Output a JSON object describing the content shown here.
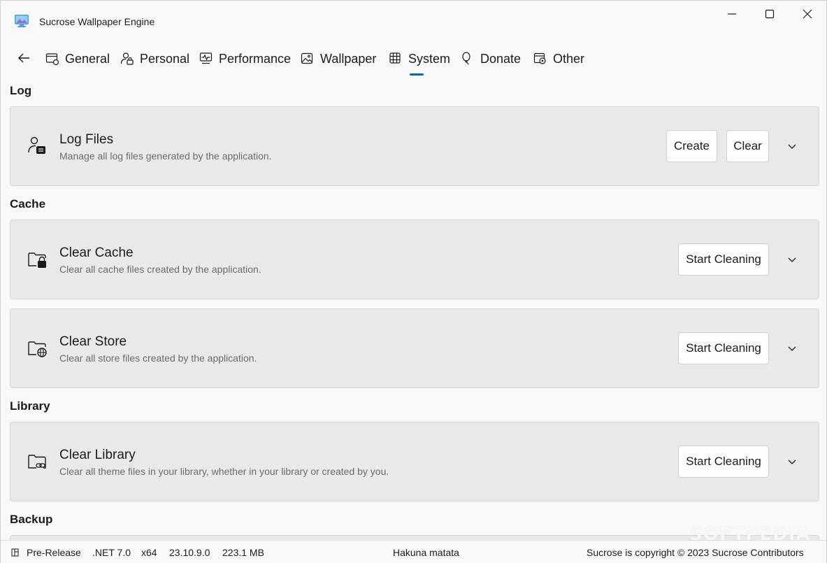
{
  "window": {
    "title": "Sucrose Wallpaper Engine"
  },
  "nav": {
    "tabs": [
      {
        "label": "General",
        "icon": "general-icon"
      },
      {
        "label": "Personal",
        "icon": "personal-lock-icon"
      },
      {
        "label": "Performance",
        "icon": "performance-icon"
      },
      {
        "label": "Wallpaper",
        "icon": "image-icon"
      },
      {
        "label": "System",
        "icon": "system-icon",
        "selected": true
      },
      {
        "label": "Donate",
        "icon": "balloon-icon"
      },
      {
        "label": "Other",
        "icon": "other-gear-icon"
      }
    ],
    "accent_color": "#0067c0"
  },
  "sections": {
    "log": {
      "title": "Log",
      "card": {
        "title": "Log Files",
        "description": "Manage all log files generated by the application.",
        "buttons": [
          "Create",
          "Clear"
        ]
      }
    },
    "cache": {
      "title": "Cache",
      "cards": [
        {
          "title": "Clear Cache",
          "description": "Clear all cache files created by the application.",
          "button": "Start Cleaning"
        },
        {
          "title": "Clear Store",
          "description": "Clear all store files created by the application.",
          "button": "Start Cleaning"
        }
      ]
    },
    "library": {
      "title": "Library",
      "card": {
        "title": "Clear Library",
        "description": "Clear all theme files in your library, whether in your library or created by you.",
        "button": "Start Cleaning"
      }
    },
    "backup": {
      "title": "Backup"
    }
  },
  "statusbar": {
    "channel": "Pre-Release",
    "framework": ".NET 7.0",
    "arch": "x64",
    "version": "23.10.9.0",
    "memory": "223.1 MB",
    "message": "Hakuna matata",
    "copyright": "Sucrose is copyright © 2023 Sucrose Contributors"
  },
  "watermark": "SOFTPEDIA"
}
